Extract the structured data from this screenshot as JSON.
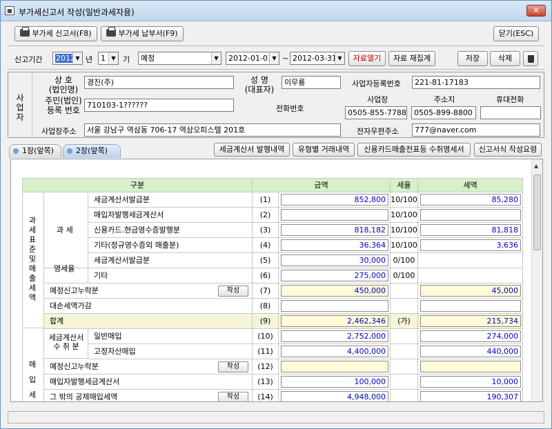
{
  "window": {
    "title": "부가세신고서 작성(일반과세자용)",
    "close_label": "✕"
  },
  "toolbar": {
    "report_btn": "부가세 신고서(F8)",
    "payment_btn": "부가세 납부서(F9)",
    "close_btn": "닫기(ESC)"
  },
  "period": {
    "label": "신고기간",
    "year": "2012",
    "year_suffix": "년",
    "term": "1",
    "term_suffix": "기",
    "type": "예정",
    "from": "2012-01-01",
    "sep": "~",
    "to": "2012-03-31",
    "load_btn": "자료열기",
    "recount_btn": "자료 재집계",
    "save_btn": "저장",
    "delete_btn": "삭제"
  },
  "business": {
    "side_label": "사업자",
    "company_label1": "상    호",
    "company_label2": "(법인명)",
    "company": "경진(주)",
    "name_label1": "성    명",
    "name_label2": "(대표자)",
    "name": "이무룡",
    "regno_label": "사업자등록번호",
    "regno": "221-81-17183",
    "idno_label1": "주민(법인)",
    "idno_label2": "등록 번호",
    "idno": "710103-1??????",
    "phone_label": "전화번호",
    "phone_biz_label": "사업장",
    "phone_home_label": "주소지",
    "phone_mobile_label": "휴대전화",
    "phone_biz": "0505-855-7788",
    "phone_home": "0505-899-8800",
    "phone_mobile": "",
    "addr_label": "사업장주소",
    "addr": "서울 강남구 역삼동 706-17 역삼오피스텔 201호",
    "email_label": "전자우편주소",
    "email": "777@naver.com"
  },
  "tabs": [
    {
      "label": "1장(앞쪽)"
    },
    {
      "label": "2장(앞쪽)"
    }
  ],
  "links": {
    "tax_invoice": "세금계산서 발행내역",
    "by_type": "유형별 거래내역",
    "card_sales": "신용카드매출전표등 수취명세서",
    "guide": "신고서식 작성요령"
  },
  "table": {
    "headers": {
      "division": "구분",
      "amount": "금액",
      "rate": "세율",
      "tax": "세액"
    },
    "group_sales": "과세표준 및 매출세액",
    "group_taxable": "과  세",
    "group_zero": "영세율",
    "group_purchase": "매 입 세",
    "group_invoice1": "세금계산서",
    "group_invoice2": "수 취 분",
    "write_label": "작성",
    "rows": [
      {
        "name": "세금계산서발급분",
        "no": "(1)",
        "amount": "852,800",
        "rate": "10/100",
        "tax": "85,280"
      },
      {
        "name": "매입자발행세금계산서",
        "no": "(2)",
        "amount": "",
        "rate": "10/100",
        "tax": ""
      },
      {
        "name": "신용카드.현금영수증발행분",
        "no": "(3)",
        "amount": "818,182",
        "rate": "10/100",
        "tax": "81,818"
      },
      {
        "name": "기타(정규영수증외 매출분)",
        "no": "(4)",
        "amount": "36,364",
        "rate": "10/100",
        "tax": "3,636"
      },
      {
        "name": "세금계산서발급분",
        "no": "(5)",
        "amount": "30,000",
        "rate": "0/100",
        "tax": ""
      },
      {
        "name": "기타",
        "no": "(6)",
        "amount": "275,000",
        "rate": "0/100",
        "tax": ""
      },
      {
        "name": "예정신고누락분",
        "no": "(7)",
        "amount": "450,000",
        "rate": "",
        "tax": "45,000"
      },
      {
        "name": "대손세액가감",
        "no": "(8)",
        "amount": "",
        "rate": "",
        "tax": ""
      },
      {
        "name": "합계",
        "no": "(9)",
        "amount": "2,462,346",
        "rate": "(가)",
        "tax": "215,734"
      },
      {
        "name": "일반매입",
        "no": "(10)",
        "amount": "2,752,000",
        "rate": "",
        "tax": "274,000"
      },
      {
        "name": "고정자산매입",
        "no": "(11)",
        "amount": "4,400,000",
        "rate": "",
        "tax": "440,000"
      },
      {
        "name": "예정신고누락분",
        "no": "(12)",
        "amount": "",
        "rate": "",
        "tax": ""
      },
      {
        "name": "매입자발행세금계산서",
        "no": "(13)",
        "amount": "100,000",
        "rate": "",
        "tax": "10,000"
      },
      {
        "name": "그 밖의 공제매입세액",
        "no": "(14)",
        "amount": "4,948,000",
        "rate": "",
        "tax": "190,307"
      }
    ]
  }
}
